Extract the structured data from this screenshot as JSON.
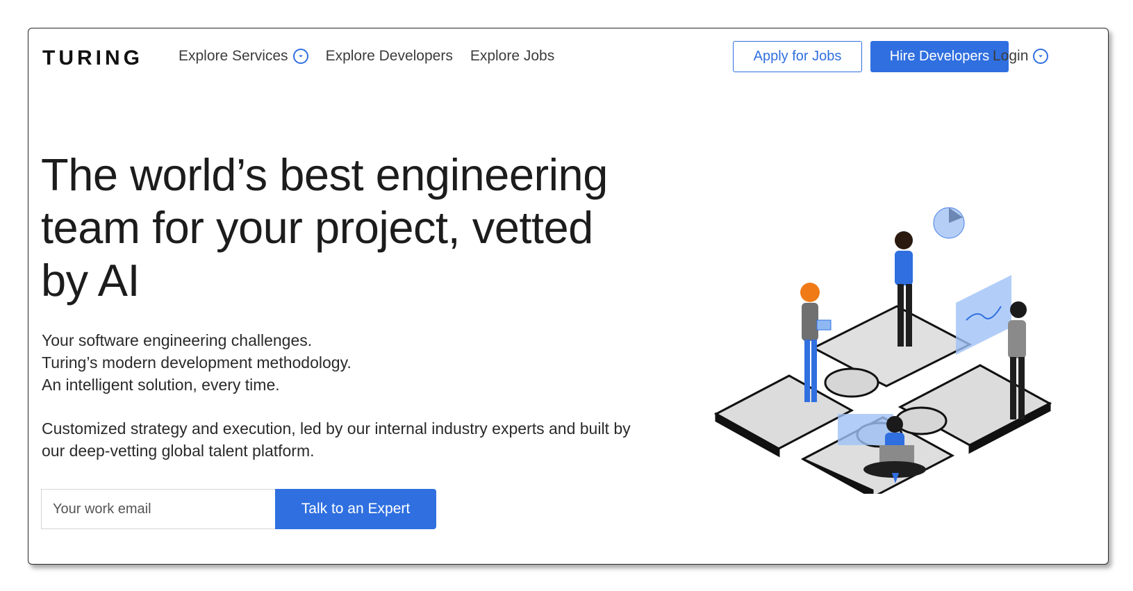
{
  "nav": {
    "logo": "TURING",
    "links": [
      {
        "label": "Explore Services",
        "has_dropdown": true
      },
      {
        "label": "Explore Developers",
        "has_dropdown": false
      },
      {
        "label": "Explore Jobs",
        "has_dropdown": false
      }
    ],
    "apply_label": "Apply for Jobs",
    "hire_label": "Hire Developers",
    "login_label": "Login"
  },
  "hero": {
    "headline_lines": [
      "The world’s best engineering",
      "team for your project, vetted",
      "by AI"
    ],
    "sub_lines": [
      "Your software engineering challenges.",
      "Turing’s modern development methodology.",
      "An intelligent solution, every time."
    ],
    "description_lines": [
      "Customized strategy and execution, led by our internal industry experts and built by",
      "our deep-vetting global talent platform."
    ],
    "email_placeholder": "Your work email",
    "cta_label": "Talk to an Expert"
  },
  "icons": {
    "dropdown": "chevron-down-circle-icon",
    "illustration": "puzzle-team-illustration"
  },
  "colors": {
    "accent": "#2f6fe0",
    "text": "#1c1c1c",
    "frame_border": "#2b2b2b"
  }
}
